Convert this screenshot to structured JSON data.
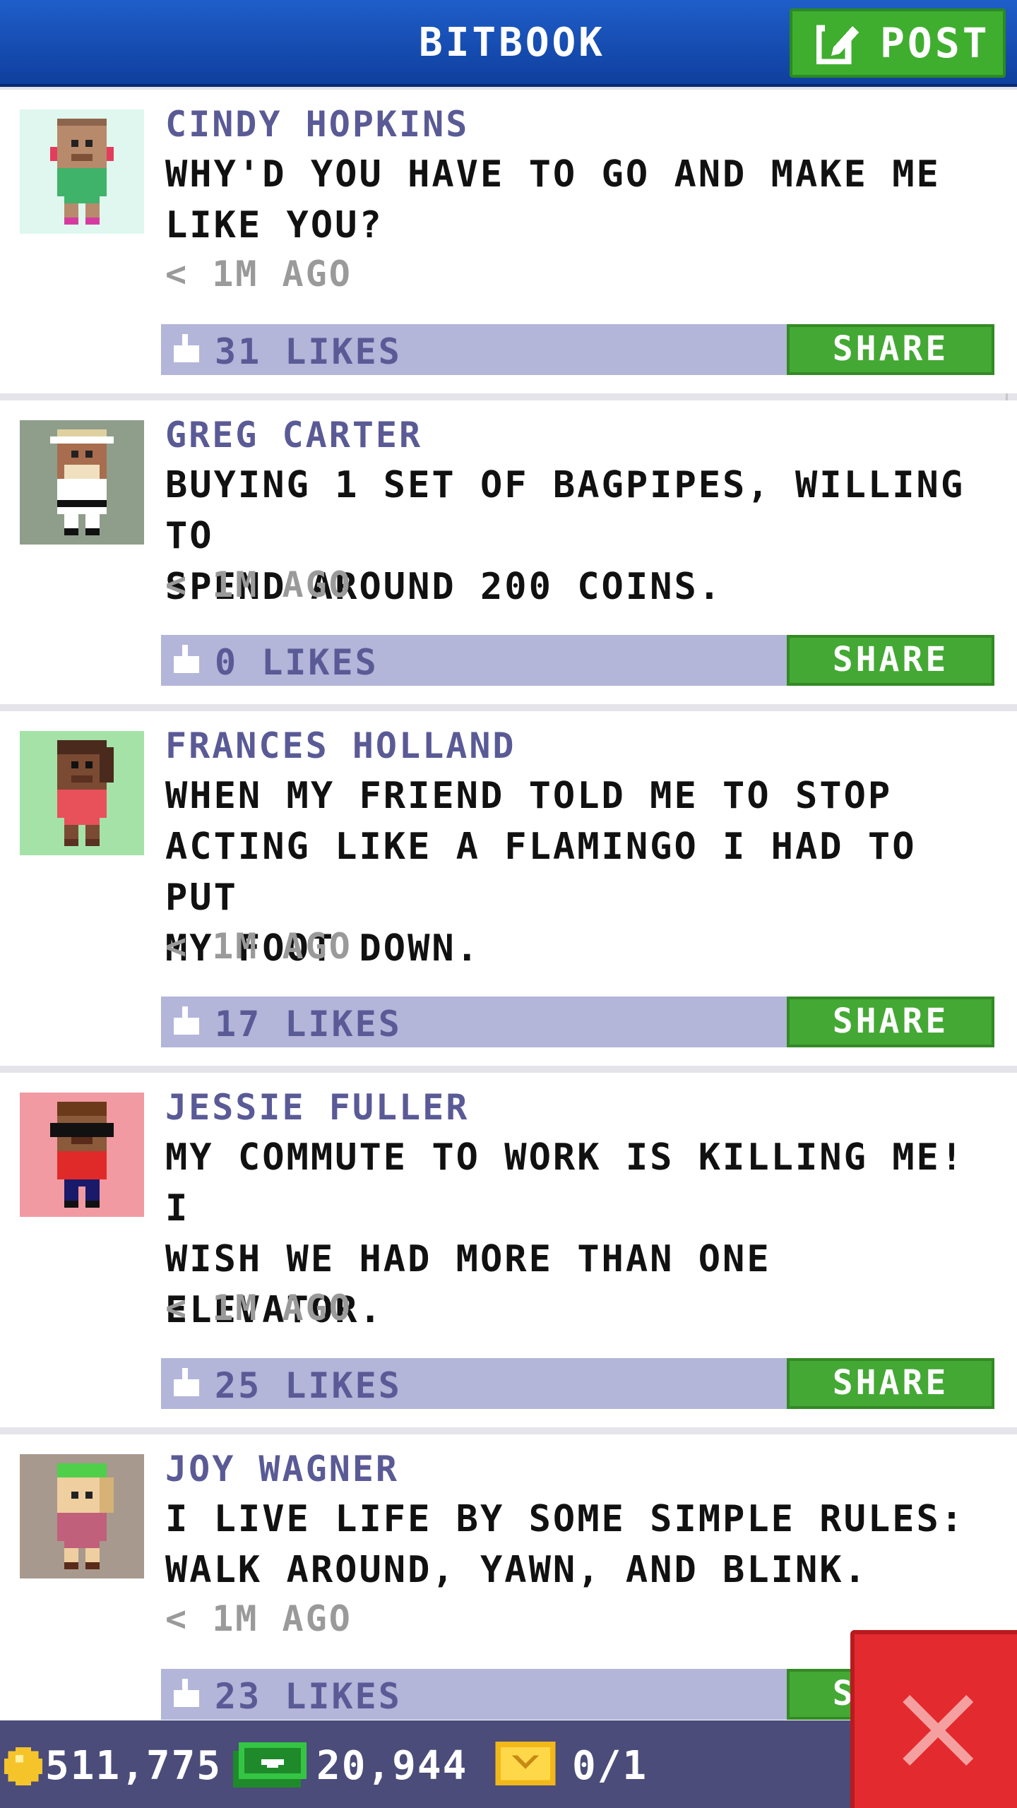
{
  "header": {
    "title": "BITBOOK",
    "post_label": "POST"
  },
  "posts": [
    {
      "author": "CINDY HOPKINS",
      "lines": [
        "WHY'D YOU HAVE TO GO AND MAKE ME",
        "LIKE YOU?"
      ],
      "time": "< 1M AGO",
      "likes": "31 LIKES",
      "share": "SHARE",
      "avatar_bg": "#dff7ee",
      "avatar": "cindy-avatar-icon"
    },
    {
      "author": "GREG CARTER",
      "lines": [
        "BUYING 1 SET OF BAGPIPES, WILLING TO",
        "SPEND AROUND 200 COINS."
      ],
      "time": "< 1M AGO",
      "likes": "0 LIKES",
      "share": "SHARE",
      "avatar_bg": "#8f9e8b",
      "avatar": "greg-avatar-icon"
    },
    {
      "author": "FRANCES HOLLAND",
      "lines": [
        "WHEN MY FRIEND TOLD ME TO STOP",
        "ACTING LIKE A FLAMINGO I HAD TO PUT",
        "MY FOOT DOWN."
      ],
      "time": "< 1M AGO",
      "likes": "17 LIKES",
      "share": "SHARE",
      "avatar_bg": "#a5e2a8",
      "avatar": "frances-avatar-icon"
    },
    {
      "author": "JESSIE FULLER",
      "lines": [
        "MY COMMUTE TO WORK IS KILLING ME! I",
        "WISH WE HAD MORE THAN ONE",
        "ELEVATOR."
      ],
      "time": "< 1M AGO",
      "likes": "25 LIKES",
      "share": "SHARE",
      "avatar_bg": "#f19aa2",
      "avatar": "jessie-avatar-icon"
    },
    {
      "author": "JOY WAGNER",
      "lines": [
        "I LIVE LIFE BY SOME SIMPLE RULES:",
        "WALK AROUND, YAWN, AND BLINK."
      ],
      "time": "< 1M AGO",
      "likes": "23 LIKES",
      "share": "SHARE",
      "avatar_bg": "#a8998e",
      "avatar": "joy-avatar-icon"
    }
  ],
  "status": {
    "coins": "511,775",
    "bux": "20,944",
    "tickets": "0/1"
  },
  "colors": {
    "header": "#1f5ec9",
    "post_green": "#3fae2f",
    "like_bar": "#b3b5d9",
    "author": "#5a5a96",
    "status_bar": "#4b4c7a",
    "close_red": "#e32a2e"
  }
}
